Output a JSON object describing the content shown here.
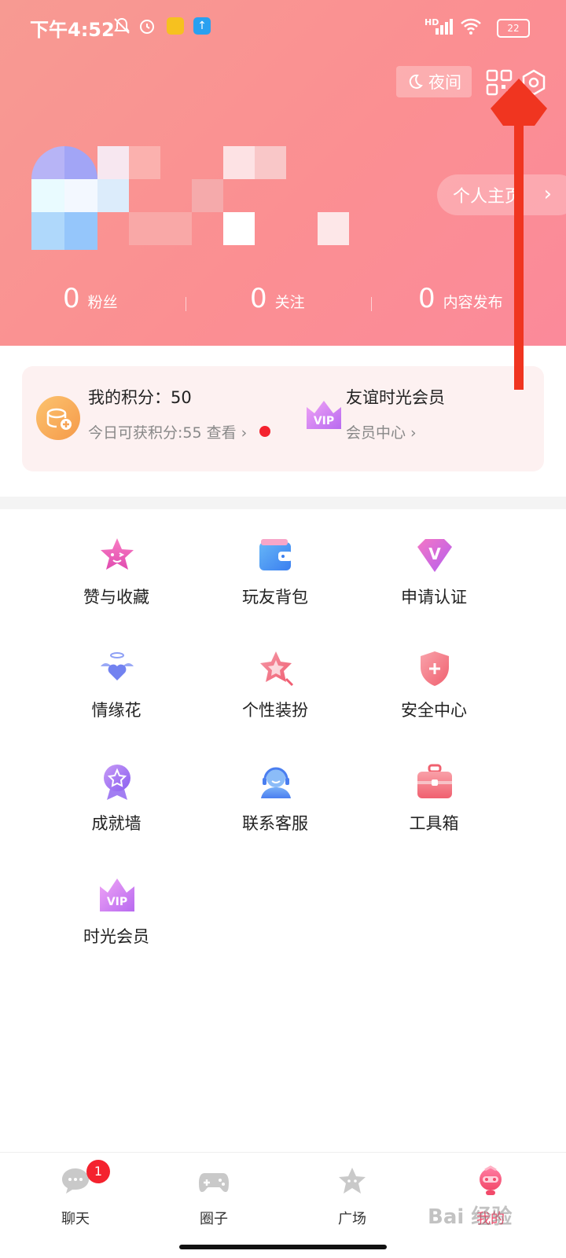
{
  "status_bar": {
    "time": "下午4:52",
    "battery": "22",
    "network": "HD"
  },
  "header": {
    "night_label": "夜间",
    "profile_button": "个人主页",
    "stats": [
      {
        "value": "0",
        "label": "粉丝"
      },
      {
        "value": "0",
        "label": "关注"
      },
      {
        "value": "0",
        "label": "内容发布"
      }
    ]
  },
  "card": {
    "points_title": "我的积分：50",
    "points_sub": "今日可获积分:55 查看 ›",
    "vip_title": "友谊时光会员",
    "vip_sub": "会员中心 ›"
  },
  "grid": [
    {
      "label": "赞与收藏",
      "icon": "star-face-icon",
      "color": "#f26bc1"
    },
    {
      "label": "玩友背包",
      "icon": "wallet-icon",
      "color": "#4a90f0"
    },
    {
      "label": "申请认证",
      "icon": "verify-v-icon",
      "color": "#d45bf0"
    },
    {
      "label": "情缘花",
      "icon": "winged-heart-icon",
      "color": "#7c8ff0"
    },
    {
      "label": "个性装扮",
      "icon": "decoration-star-icon",
      "color": "#f5707f"
    },
    {
      "label": "安全中心",
      "icon": "shield-icon",
      "color": "#f56e7c"
    },
    {
      "label": "成就墙",
      "icon": "medal-icon",
      "color": "#9b6cf0"
    },
    {
      "label": "联系客服",
      "icon": "customer-service-icon",
      "color": "#5a8ef5"
    },
    {
      "label": "工具箱",
      "icon": "toolbox-icon",
      "color": "#f5707f"
    },
    {
      "label": "时光会员",
      "icon": "vip-crown-icon",
      "color": "#c26cf0"
    }
  ],
  "bottom_nav": {
    "items": [
      {
        "label": "聊天",
        "icon": "chat-icon"
      },
      {
        "label": "圈子",
        "icon": "gamepad-icon"
      },
      {
        "label": "广场",
        "icon": "star-icon"
      },
      {
        "label": "我的",
        "icon": "profile-avatar-icon"
      }
    ],
    "chat_badge": "1"
  },
  "watermark": "Bai 经验"
}
